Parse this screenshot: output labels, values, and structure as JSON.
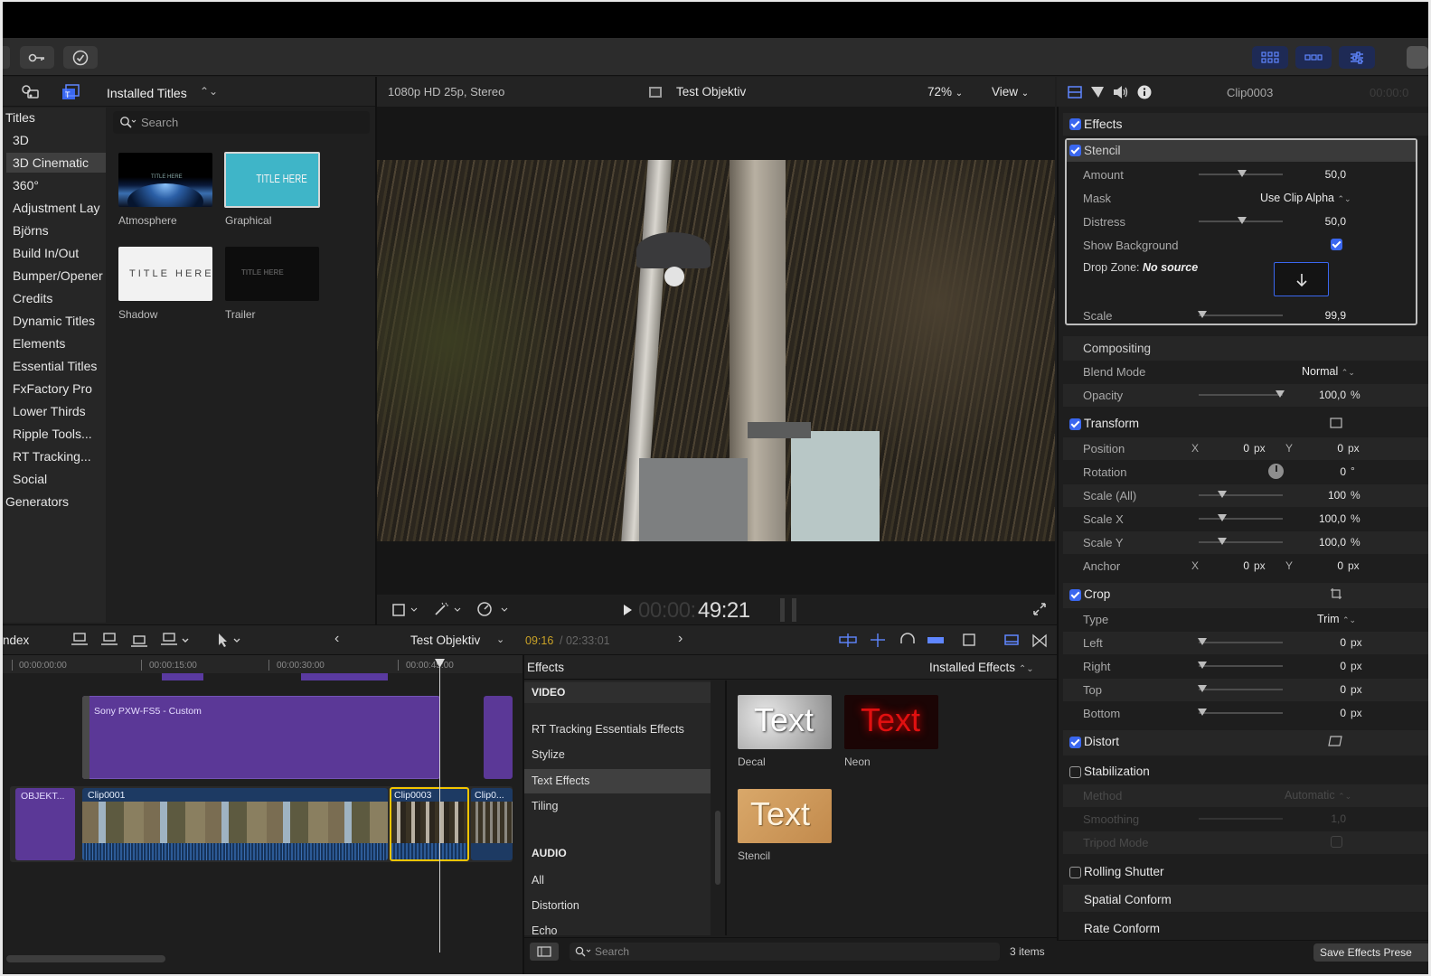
{
  "browser": {
    "header_title": "Installed Titles",
    "search_placeholder": "Search",
    "sidebar": [
      {
        "label": "Titles"
      },
      {
        "label": "3D"
      },
      {
        "label": "3D Cinematic"
      },
      {
        "label": "360°"
      },
      {
        "label": "Adjustment Lay"
      },
      {
        "label": "Björns"
      },
      {
        "label": "Build In/Out"
      },
      {
        "label": "Bumper/Opener"
      },
      {
        "label": "Credits"
      },
      {
        "label": "Dynamic Titles"
      },
      {
        "label": "Elements"
      },
      {
        "label": "Essential Titles"
      },
      {
        "label": "FxFactory Pro"
      },
      {
        "label": "Lower Thirds"
      },
      {
        "label": "Ripple Tools..."
      },
      {
        "label": "RT Tracking..."
      },
      {
        "label": "Social"
      },
      {
        "label": "Generators"
      }
    ],
    "thumbs": [
      {
        "label": "Atmosphere",
        "overlay": "TITLE HERE"
      },
      {
        "label": "Graphical",
        "overlay": "TITLE HERE"
      },
      {
        "label": "Shadow",
        "overlay": "TITLE HERE"
      },
      {
        "label": "Trailer",
        "overlay": "TITLE HERE"
      }
    ]
  },
  "viewer": {
    "format": "1080p HD 25p, Stereo",
    "project": "Test Objektiv",
    "zoom": "72%",
    "view_label": "View",
    "timecode_dim": "00:00:",
    "timecode": "49:21"
  },
  "inspector": {
    "clip_name": "Clip0003",
    "clip_time": "00:00:0",
    "effects_label": "Effects",
    "stencil": {
      "title": "Stencil",
      "amount_label": "Amount",
      "amount_value": "50,0",
      "mask_label": "Mask",
      "mask_value": "Use Clip Alpha",
      "distress_label": "Distress",
      "distress_value": "50,0",
      "show_bg_label": "Show Background",
      "drop_zone_label": "Drop Zone:",
      "drop_zone_value": "No source",
      "scale_label": "Scale",
      "scale_value": "99,9"
    },
    "compositing": {
      "title": "Compositing",
      "blend_label": "Blend Mode",
      "blend_value": "Normal",
      "opacity_label": "Opacity",
      "opacity_value": "100,0",
      "opacity_unit": "%"
    },
    "transform": {
      "title": "Transform",
      "position_label": "Position",
      "x_label": "X",
      "y_label": "Y",
      "position_x": "0",
      "position_y": "0",
      "px": "px",
      "rotation_label": "Rotation",
      "rotation_value": "0",
      "deg": "°",
      "scale_all_label": "Scale (All)",
      "scale_all_value": "100",
      "scale_x_label": "Scale X",
      "scale_x_value": "100,0",
      "scale_y_label": "Scale Y",
      "scale_y_value": "100,0",
      "pct": "%",
      "anchor_label": "Anchor",
      "anchor_x": "0",
      "anchor_y": "0"
    },
    "crop": {
      "title": "Crop",
      "type_label": "Type",
      "type_value": "Trim",
      "left_label": "Left",
      "left_value": "0",
      "right_label": "Right",
      "right_value": "0",
      "top_label": "Top",
      "top_value": "0",
      "bottom_label": "Bottom",
      "bottom_value": "0"
    },
    "distort_title": "Distort",
    "stabilization": {
      "title": "Stabilization",
      "method_label": "Method",
      "method_value": "Automatic",
      "smoothing_label": "Smoothing",
      "smoothing_value": "1,0",
      "tripod_label": "Tripod Mode"
    },
    "rolling_shutter": "Rolling Shutter",
    "spatial_conform": "Spatial Conform",
    "rate_conform": "Rate Conform",
    "save_preset": "Save Effects Prese"
  },
  "timeline": {
    "index_label": "ndex",
    "project": "Test Objektiv",
    "time_current": "09:16",
    "time_total": "02:33:01",
    "ruler": [
      "00:00:00:00",
      "00:00:15:00",
      "00:00:30:00",
      "00:00:45:00"
    ],
    "clips": {
      "connected": "Sony PXW-FS5 - Custom",
      "title_clip": "OBJEKT...",
      "clip1": "Clip0001",
      "clip3": "Clip0003",
      "clip4": "Clip0..."
    }
  },
  "effects_browser": {
    "title": "Effects",
    "installed": "Installed Effects",
    "video_header": "VIDEO",
    "categories": [
      "RT Tracking Essentials Effects",
      "Stylize",
      "Text Effects",
      "Tiling"
    ],
    "audio_header": "AUDIO",
    "audio_categories": [
      "All",
      "Distortion",
      "Echo"
    ],
    "items": [
      {
        "label": "Decal",
        "preview": "Text"
      },
      {
        "label": "Neon",
        "preview": "Text"
      },
      {
        "label": "Stencil",
        "preview": "Text"
      }
    ],
    "search_placeholder": "Search",
    "count": "3 items"
  }
}
